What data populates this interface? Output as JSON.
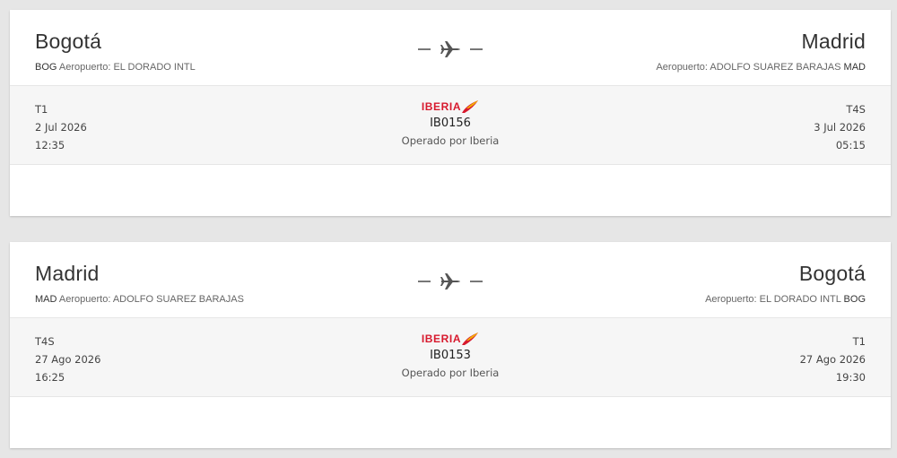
{
  "flights": [
    {
      "origin": {
        "city": "Bogotá",
        "code": "BOG",
        "airport_label": "Aeropuerto:",
        "airport_name": "EL DORADO INTL"
      },
      "destination": {
        "city": "Madrid",
        "code": "MAD",
        "airport_label": "Aeropuerto:",
        "airport_name": "ADOLFO SUAREZ BARAJAS"
      },
      "departure": {
        "terminal": "T1",
        "date": "2 Jul 2026",
        "time": "12:35"
      },
      "arrival": {
        "terminal": "T4S",
        "date": "3 Jul 2026",
        "time": "05:15"
      },
      "airline_logo": "IBERIA",
      "flight_number": "IB0156",
      "operated_by": "Operado por Iberia"
    },
    {
      "origin": {
        "city": "Madrid",
        "code": "MAD",
        "airport_label": "Aeropuerto:",
        "airport_name": "ADOLFO SUAREZ BARAJAS"
      },
      "destination": {
        "city": "Bogotá",
        "code": "BOG",
        "airport_label": "Aeropuerto:",
        "airport_name": "EL DORADO INTL"
      },
      "departure": {
        "terminal": "T4S",
        "date": "27 Ago 2026",
        "time": "16:25"
      },
      "arrival": {
        "terminal": "T1",
        "date": "27 Ago 2026",
        "time": "19:30"
      },
      "airline_logo": "IBERIA",
      "flight_number": "IB0153",
      "operated_by": "Operado por Iberia"
    }
  ],
  "icons": {
    "route": "plane-icon",
    "airline": "iberia-logo"
  },
  "colors": {
    "brand_red": "#d7192d",
    "brand_yellow": "#f4b400"
  }
}
